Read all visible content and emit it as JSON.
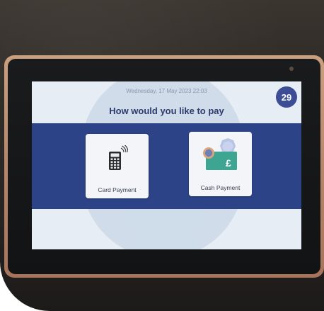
{
  "screen": {
    "datetime": "Wednesday, 17 May 2023 22:03",
    "countdown": "29",
    "heading": "How would you like to pay"
  },
  "options": [
    {
      "label": "Card Payment",
      "icon": "card-terminal-icon"
    },
    {
      "label": "Cash Payment",
      "icon": "cash-icon",
      "currency_symbol": "£"
    }
  ],
  "colors": {
    "band": "#2c4388",
    "countdown_badge": "#3c4d96",
    "heading": "#2c3b6e",
    "screen_background": "#e6edf4",
    "cash_green": "#3fa593"
  }
}
